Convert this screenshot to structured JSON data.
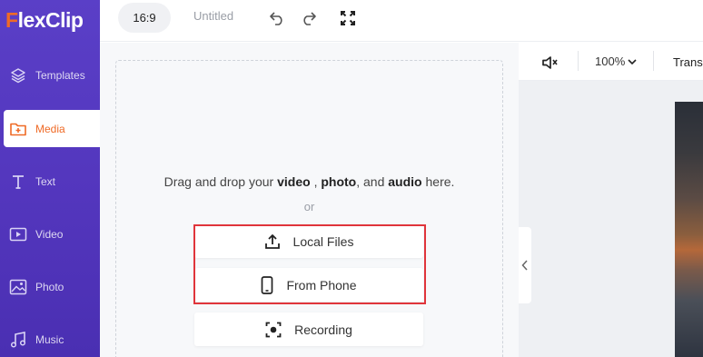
{
  "app": {
    "logo_text_f": "F",
    "logo_text_rest": "lexClip"
  },
  "sidebar": {
    "items": [
      {
        "label": "Templates",
        "icon": "layers-icon"
      },
      {
        "label": "Media",
        "icon": "folder-plus-icon",
        "active": true
      },
      {
        "label": "Text",
        "icon": "text-t-icon"
      },
      {
        "label": "Video",
        "icon": "video-play-icon"
      },
      {
        "label": "Photo",
        "icon": "image-icon"
      },
      {
        "label": "Music",
        "icon": "music-note-icon"
      }
    ]
  },
  "topbar": {
    "aspect_ratio": "16:9",
    "project_title": "Untitled",
    "undo_icon": "undo-icon",
    "redo_icon": "redo-icon",
    "fullscreen_icon": "fullscreen-icon"
  },
  "media_panel": {
    "drop_prefix": "Drag and drop your",
    "drop_video": "video",
    "drop_comma1": ",",
    "drop_photo": "photo",
    "drop_and": ", and",
    "drop_audio": "audio",
    "drop_suffix": "here.",
    "or": "or",
    "local_files": "Local Files",
    "from_phone": "From Phone",
    "recording": "Recording"
  },
  "preview_toolbar": {
    "zoom": "100%",
    "transition_label": "Trans"
  },
  "colors": {
    "sidebar": "#5a3fc7",
    "accent": "#ef6a26",
    "highlight": "#e0353b"
  }
}
